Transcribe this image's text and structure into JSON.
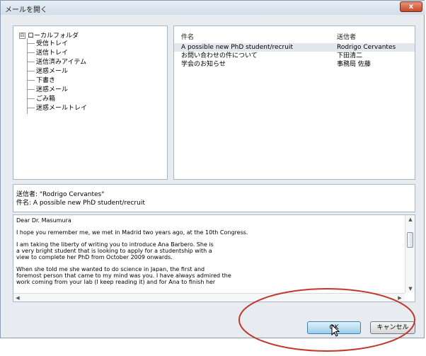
{
  "window": {
    "title": "メールを開く",
    "close_label": "x"
  },
  "folder_tree": {
    "root": "ローカルフォルダ",
    "root_toggle": "⊟",
    "items": [
      "受信トレイ",
      "送信トレイ",
      "送信済みアイテム",
      "迷惑メール",
      "下書き",
      "迷惑メール",
      "ごみ箱",
      "迷惑メールトレイ"
    ]
  },
  "mail_list": {
    "columns": {
      "subject": "件名",
      "sender": "送信者"
    },
    "rows": [
      {
        "subject": "A possible new PhD student/recruit",
        "sender": "Rodrigo Cervantes"
      },
      {
        "subject": "お問い合わせの件について",
        "sender": "下田清二"
      },
      {
        "subject": "学会のお知らせ",
        "sender": "事務局 佐藤"
      }
    ]
  },
  "header": {
    "from": "送信者: \"Rodrigo Cervantes\"",
    "subject": "件名: A possible new PhD student/recruit"
  },
  "body": {
    "greeting": "Dear Dr. Masumura",
    "p1": "I hope you remember me, we met in Madrid two years ago, at the 10th Congress.",
    "p2": "I am taking the liberty of writing you to introduce Ana Barbero.  She is\na very bright student that is looking to apply for a studentship with a\nview to complete her PhD from October 2009 onwards.",
    "p3": "When she told me she wanted to do science in Japan, the first and\nforemost person that came to my mind was you.  I have always admired the\nwork coming from your lab (I keep reading it) and for Ana to finish her"
  },
  "scroll": {
    "up": "▲",
    "down": "▼",
    "left": "◀",
    "right": "▶"
  },
  "buttons": {
    "ok": "OK",
    "cancel": "キャンセル"
  },
  "annotation": {
    "color": "#c0392b"
  },
  "colors": {
    "selected_row": "#e3e8ee",
    "ok_border": "#3c7fb1"
  }
}
